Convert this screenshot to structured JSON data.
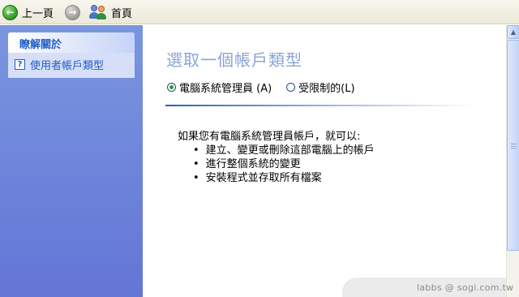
{
  "toolbar": {
    "back_label": "上一頁",
    "back_icon": "back-arrow-icon",
    "forward_icon": "forward-arrow-icon",
    "home_label": "首頁",
    "home_icon": "users-icon"
  },
  "sidebar": {
    "header": "瞭解關於",
    "items": [
      {
        "label": "使用者帳戶類型",
        "icon": "help-icon"
      }
    ]
  },
  "main": {
    "title": "選取一個帳戶類型",
    "options": [
      {
        "label": "電腦系統管理員 (A)",
        "selected": true
      },
      {
        "label": "受限制的(L)",
        "selected": false
      }
    ],
    "description": "如果您有電腦系統管理員帳戶，就可以:",
    "bullets": [
      "建立、變更或刪除這部電腦上的帳戶",
      "進行整個系統的變更",
      "安裝程式並存取所有檔案"
    ]
  },
  "watermark": "labbs  @ sogi.com.tw",
  "colors": {
    "sidebar_bg": "#6f86db",
    "title": "#8aa4d6",
    "link": "#215dc6",
    "radio_dot": "#21a121"
  }
}
